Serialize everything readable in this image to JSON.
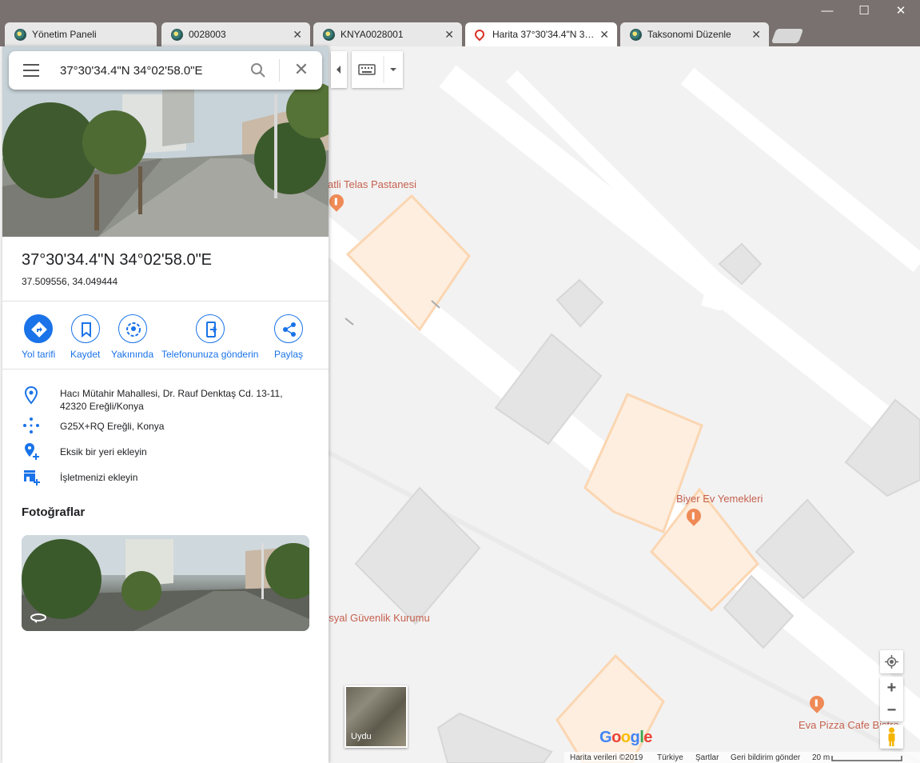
{
  "browser": {
    "tabs": [
      {
        "label": "Yönetim Paneli",
        "active": false
      },
      {
        "label": "0028003",
        "active": false
      },
      {
        "label": "KNYA0028001",
        "active": false
      },
      {
        "label": "Harita 37°30'34.4\"N 3…",
        "active": true
      },
      {
        "label": "Taksonomi Düzenle",
        "active": false
      }
    ],
    "window_controls": {
      "minimize": "—",
      "maximize": "☐",
      "close": "✕"
    }
  },
  "search": {
    "value": "37°30'34.4\"N 34°02'58.0\"E"
  },
  "place": {
    "title": "37°30'34.4\"N 34°02'58.0\"E",
    "decimal": "37.509556, 34.049444"
  },
  "actions": [
    {
      "label": "Yol tarifi",
      "icon": "directions-icon"
    },
    {
      "label": "Kaydet",
      "icon": "bookmark-icon"
    },
    {
      "label": "Yakınında",
      "icon": "nearby-icon"
    },
    {
      "label": "Telefonunuza gönderin",
      "icon": "send-to-phone-icon"
    },
    {
      "label": "Paylaş",
      "icon": "share-icon"
    }
  ],
  "info": {
    "address_line1": "Hacı Mütahir Mahallesi, Dr. Rauf Denktaş Cd. 13-11,",
    "address_line2": "42320 Ereğli/Konya",
    "plus_code": "G25X+RQ Ereğli, Konya",
    "add_missing": "Eksik bir yeri ekleyin",
    "add_business": "İşletmenizi ekleyin"
  },
  "photos": {
    "title": "Fotoğraflar"
  },
  "map": {
    "labels": {
      "bakery": "atli Telas Pastanesi",
      "restaurant": "Biyer Ev Yemekleri",
      "social": "osyal Güvenlik Kurumu",
      "pizza": "Eva Pizza Cafe Bistro"
    },
    "satellite_label": "Uydu",
    "google_logo": "Google",
    "footer": {
      "data": "Harita verileri ©2019",
      "country": "Türkiye",
      "terms": "Şartlar",
      "feedback": "Geri bildirim gönder",
      "scale": "20 m"
    },
    "colors": {
      "building": "#e6e6e6",
      "poi_building": "#fde9d6",
      "poi_outline": "#fbd2aa",
      "road": "#ffffff",
      "label": "#c5614f",
      "accent": "#1a73e8"
    }
  }
}
